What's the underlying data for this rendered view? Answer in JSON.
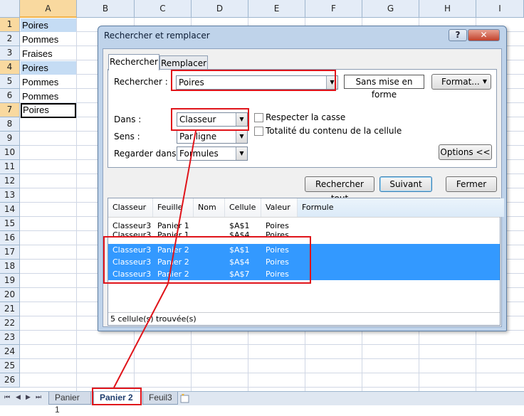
{
  "sheet": {
    "columns": [
      "A",
      "B",
      "C",
      "D",
      "E",
      "F",
      "G",
      "H",
      "I"
    ],
    "rows": [
      "1",
      "2",
      "3",
      "4",
      "5",
      "6",
      "7",
      "8",
      "9",
      "10",
      "11",
      "12",
      "13",
      "14",
      "15",
      "16",
      "17",
      "18",
      "19",
      "20",
      "21",
      "22",
      "23",
      "24",
      "25",
      "26"
    ],
    "cells": [
      "Poires",
      "Pommes",
      "Fraises",
      "Poires",
      "Pommes",
      "Pommes",
      "Poires"
    ],
    "highlight_color": "#c5dcf4",
    "header_color": "#e4ecf7"
  },
  "tabs": {
    "items": [
      "Panier 1",
      "Panier 2",
      "Feuil3"
    ],
    "active": "Panier 2",
    "nav_icons": [
      "first-sheet-icon",
      "prev-sheet-icon",
      "next-sheet-icon",
      "last-sheet-icon"
    ]
  },
  "dialog": {
    "title": "Rechercher et remplacer",
    "help": "?",
    "close": "✕",
    "tab_find": "Rechercher",
    "tab_replace": "Remplacer",
    "find_label": "Rechercher :",
    "find_value": "Poires",
    "format_preview": "Sans mise en forme",
    "format_button": "Format...",
    "within_label": "Dans :",
    "within_value": "Classeur",
    "search_label": "Sens :",
    "search_value": "Par ligne",
    "lookin_label": "Regarder dans :",
    "lookin_value": "Formules",
    "match_case": "Respecter la casse",
    "match_entire": "Totalité du contenu de la cellule",
    "options_button": "Options <<",
    "find_all": "Rechercher tout",
    "find_next": "Suivant",
    "close_button": "Fermer",
    "results": {
      "headers": [
        "Classeur",
        "Feuille",
        "Nom",
        "Cellule",
        "Valeur",
        "Formule"
      ],
      "rows": [
        [
          "Classeur3",
          "Panier 1",
          "",
          "$A$1",
          "Poires",
          ""
        ],
        [
          "Classeur3",
          "Panier 1",
          "",
          "$A$4",
          "Poires",
          ""
        ],
        [
          "Classeur3",
          "Panier 2",
          "",
          "$A$1",
          "Poires",
          ""
        ],
        [
          "Classeur3",
          "Panier 2",
          "",
          "$A$4",
          "Poires",
          ""
        ],
        [
          "Classeur3",
          "Panier 2",
          "",
          "$A$7",
          "Poires",
          ""
        ]
      ],
      "status": "5 cellule(s) trouvée(s)"
    }
  },
  "colors": {
    "annotation": "#e0141a",
    "selection": "#3399ff",
    "dialog_frame": "#bfd3ea"
  }
}
